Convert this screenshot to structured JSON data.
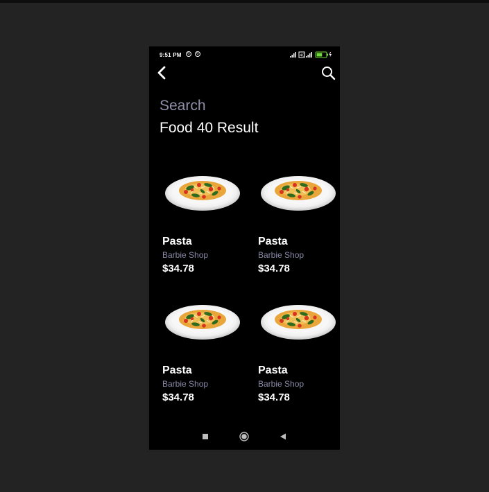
{
  "status_bar": {
    "time": "9:51 PM",
    "app_icons": [
      "sync-icon",
      "sync-icon"
    ],
    "right_icons": [
      "signal-icon",
      "hd-icon",
      "signal-icon",
      "battery-icon"
    ],
    "battery_level": 0.6
  },
  "app_bar": {
    "back_icon": "chevron-left-icon",
    "search_icon": "search-icon"
  },
  "header": {
    "subtitle": "Search",
    "title": "Food 40 Result"
  },
  "products": [
    {
      "name": "Pasta",
      "shop": "Barbie Shop",
      "price": "$34.78",
      "image": "pasta-plate"
    },
    {
      "name": "Pasta",
      "shop": "Barbie Shop",
      "price": "$34.78",
      "image": "pasta-plate"
    },
    {
      "name": "Pasta",
      "shop": "Barbie Shop",
      "price": "$34.78",
      "image": "pasta-plate"
    },
    {
      "name": "Pasta",
      "shop": "Barbie Shop",
      "price": "$34.78",
      "image": "pasta-plate"
    }
  ],
  "nav_bar": {
    "buttons": [
      "recents-square-icon",
      "home-circle-icon",
      "back-triangle-icon"
    ]
  },
  "colors": {
    "background": "#232323",
    "screen": "#000000",
    "subtitle": "#8f8fa8",
    "shop_text": "#8a8aa8",
    "battery": "#6fdc3c"
  }
}
